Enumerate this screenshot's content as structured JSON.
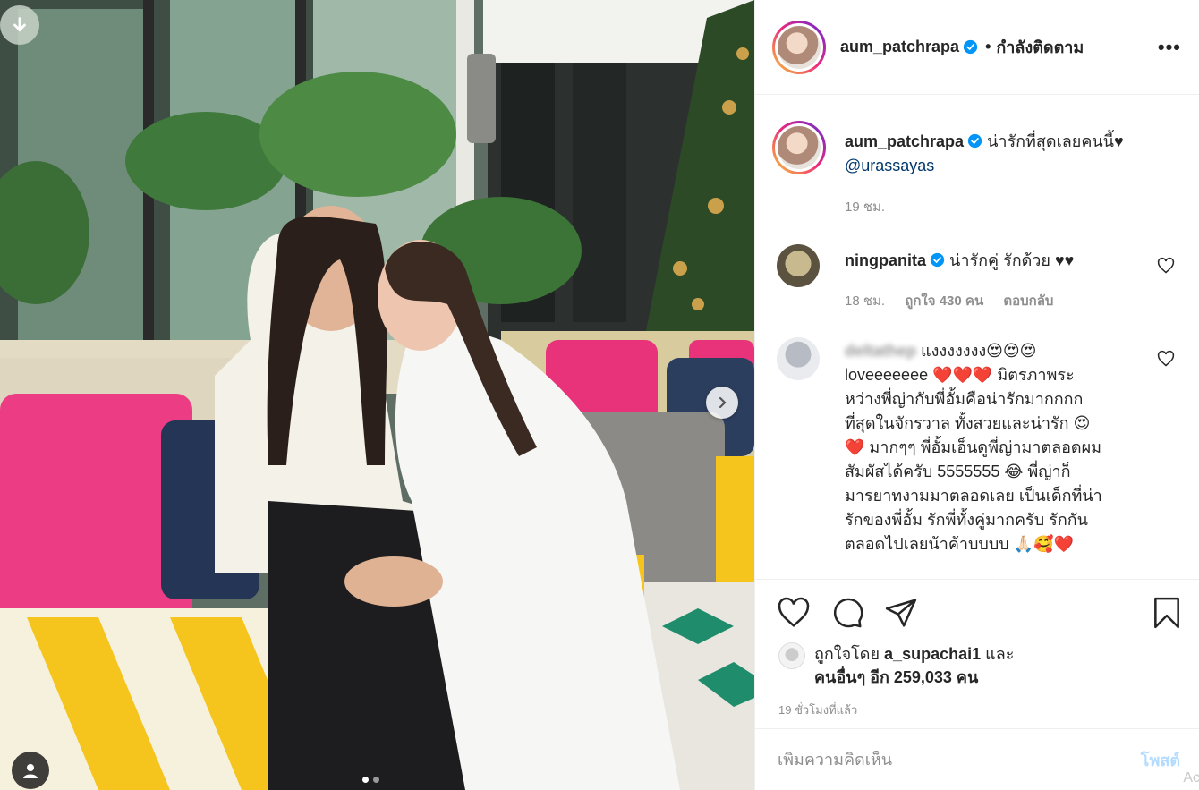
{
  "post": {
    "image_dots": 2,
    "active_dot": 0
  },
  "header": {
    "username": "aum_patchrapa",
    "separator": "•",
    "follow_state": "กำลังติดตาม",
    "more": "•••"
  },
  "caption": {
    "username": "aum_patchrapa",
    "text": "น่ารักที่สุดเลยคนนี้♥",
    "mention": "@urassayas",
    "time": "19 ชม."
  },
  "comments": [
    {
      "username": "ningpanita",
      "text": "น่ารักคู่ รักด้วย ♥♥",
      "time": "18 ชม.",
      "likes": "ถูกใจ 430 คน",
      "reply": "ตอบกลับ"
    },
    {
      "username": "deltathep",
      "lines": [
        "แงงงงงงง😍😍😍",
        "loveeeeeee ❤️❤️❤️ มิตรภาพระ",
        "หว่างพี่ญ่ากับพี่อั้มคือน่ารักมากกกก",
        "ที่สุดในจักรวาล ทั้งสวยและน่ารัก 😍",
        "❤️ มากๆๆ พี่อั้มเอ็นดูพี่ญ่ามาตลอดผม",
        "สัมผัสได้ครับ 5555555 😂 พี่ญ่าก็",
        "มารยาทงามมาตลอดเลย เป็นเด็กที่น่า",
        "รักของพี่อั้ม รักพี่ทั้งคู่มากครับ รักกัน",
        "ตลอดไปเลยน้าค้าบบบบ 🙏🏻🥰❤️"
      ]
    }
  ],
  "likes": {
    "prefix": "ถูกใจโดย ",
    "user": "a_supachai1",
    "mid": " และ",
    "others": "คนอื่นๆ อีก 259,033 คน"
  },
  "time_ago": "19 ชั่วโมงที่แล้ว",
  "add_comment": {
    "placeholder": "เพิ่มความคิดเห็น",
    "post_label": "โพสต์"
  },
  "watermark": "Ac",
  "colors": {
    "verified": "#0095f6",
    "accent_link": "#00376b",
    "post_disabled": "#b3dbff"
  }
}
